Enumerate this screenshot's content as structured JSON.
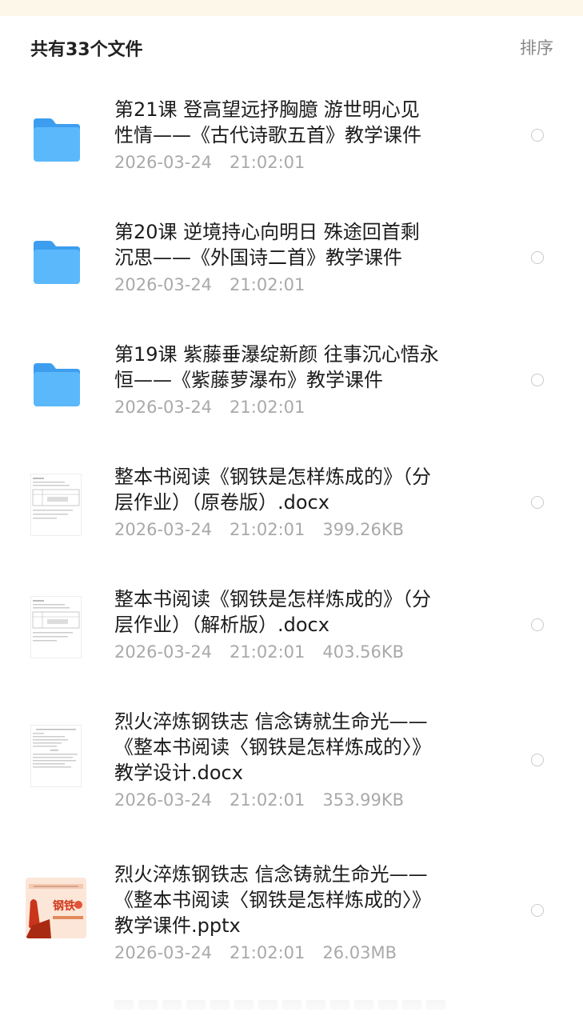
{
  "header": {
    "count_label": "共有33个文件",
    "sort_label": "排序"
  },
  "files": [
    {
      "type": "folder",
      "icon": "folder-icon",
      "name_line1": "第21课 登高望远抒胸臆  游世明心见",
      "name_line2": "性情——《古代诗歌五首》教学课件",
      "date": "2026-03-24",
      "time": "21:02:01",
      "size": ""
    },
    {
      "type": "folder",
      "icon": "folder-icon",
      "name_line1": "第20课 逆境持心向明日 殊途回首剩",
      "name_line2": "沉思——《外国诗二首》教学课件",
      "date": "2026-03-24",
      "time": "21:02:01",
      "size": ""
    },
    {
      "type": "folder",
      "icon": "folder-icon",
      "name_line1": "第19课 紫藤垂瀑绽新颜 往事沉心悟永",
      "name_line2": "恒——《紫藤萝瀑布》教学课件",
      "date": "2026-03-24",
      "time": "21:02:01",
      "size": ""
    },
    {
      "type": "docx",
      "icon": "docx-thumbnail-icon",
      "name_line1": "整本书阅读《钢铁是怎样炼成的》（分",
      "name_line2": "层作业）（原卷版）.docx",
      "date": "2026-03-24",
      "time": "21:02:01",
      "size": "399.26KB"
    },
    {
      "type": "docx",
      "icon": "docx-thumbnail-icon",
      "name_line1": "整本书阅读《钢铁是怎样炼成的》（分",
      "name_line2": "层作业）（解析版）.docx",
      "date": "2026-03-24",
      "time": "21:02:01",
      "size": "403.56KB"
    },
    {
      "type": "docx",
      "icon": "docx-thumbnail-icon",
      "name_line1": "烈火淬炼钢铁志  信念铸就生命光——",
      "name_line2": "《整本书阅读〈钢铁是怎样炼成的〉》",
      "name_line3": "教学设计.docx",
      "date": "2026-03-24",
      "time": "21:02:01",
      "size": "353.99KB"
    },
    {
      "type": "pptx",
      "icon": "pptx-thumbnail-icon",
      "name_line1": "烈火淬炼钢铁志  信念铸就生命光——",
      "name_line2": "《整本书阅读〈钢铁是怎样炼成的〉》",
      "name_line3": "教学课件.pptx",
      "date": "2026-03-24",
      "time": "21:02:01",
      "size": "26.03MB"
    }
  ],
  "colors": {
    "folder_top": "#4aa8f5",
    "folder_body": "#5bb8fb",
    "meta_text": "#a9a9a9",
    "sort_text": "#888888"
  }
}
